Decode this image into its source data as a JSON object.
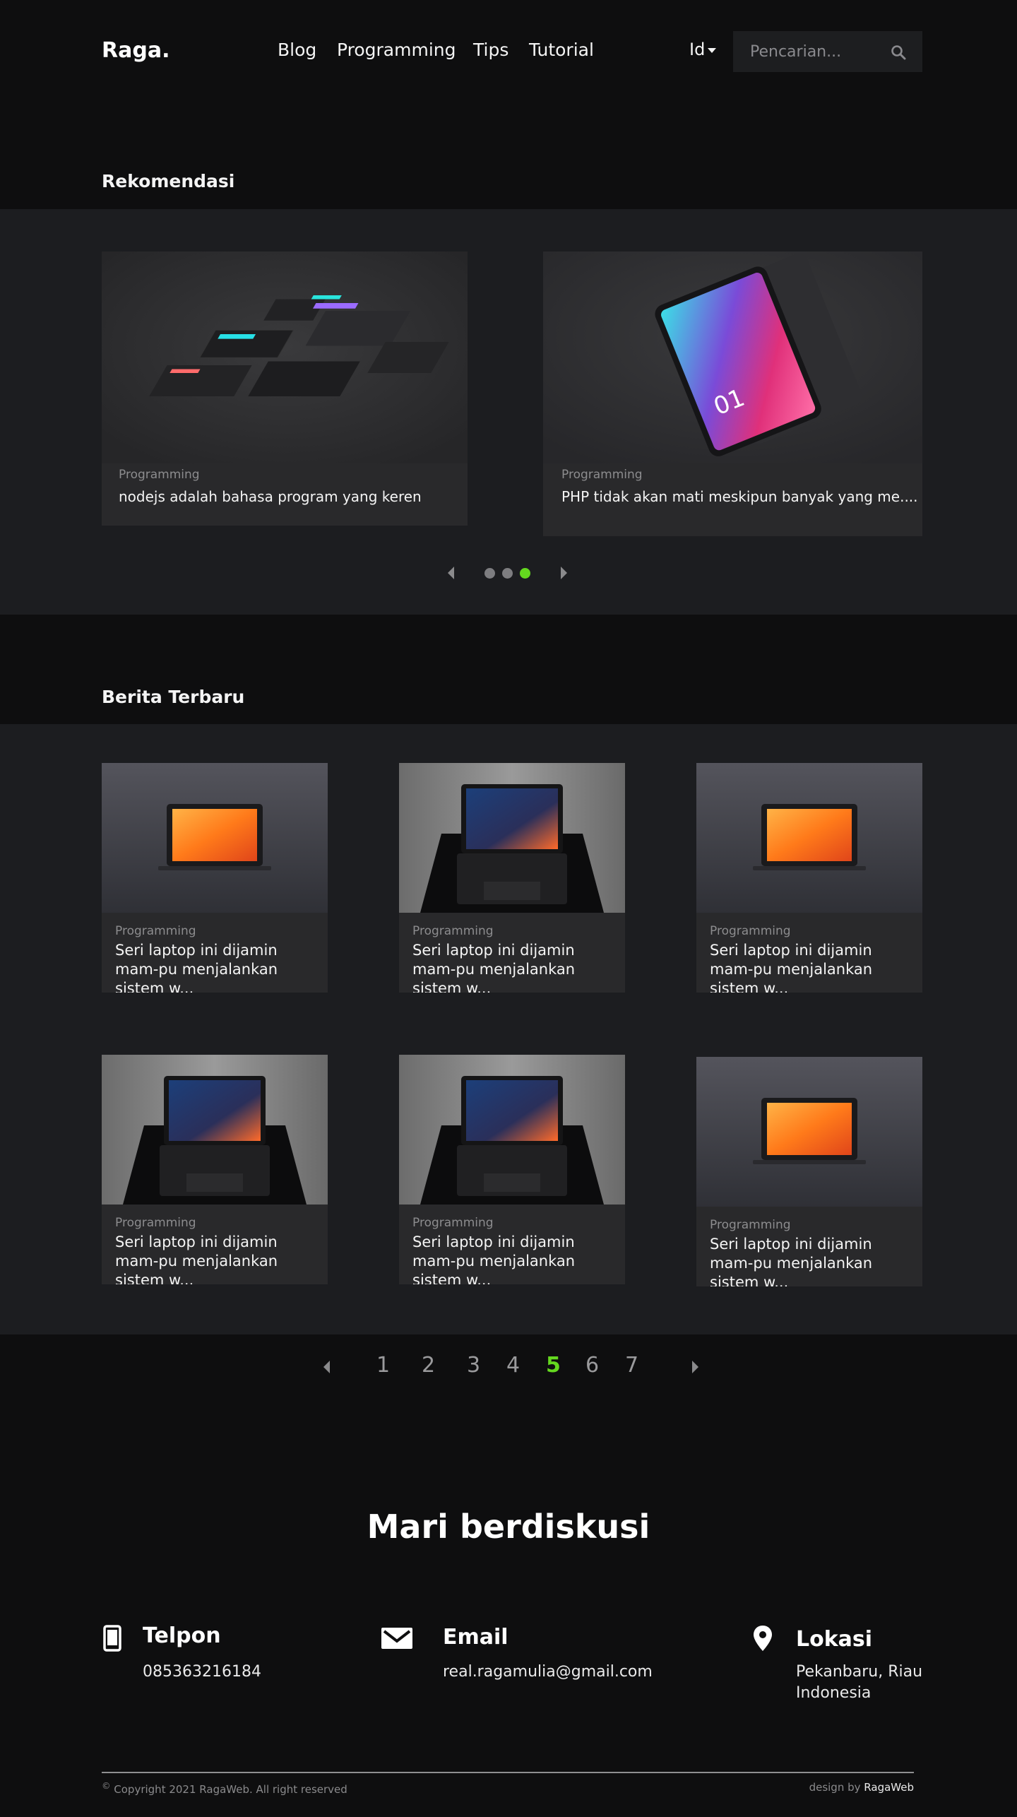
{
  "header": {
    "logo": "Raga.",
    "nav": [
      "Blog",
      "Programming",
      "Tips",
      "Tutorial"
    ],
    "lang": "Id",
    "search_placeholder": "Pencarian..."
  },
  "recommend": {
    "title": "Rekomendasi",
    "cards": [
      {
        "category": "Programming",
        "title": "nodejs adalah bahasa program yang keren"
      },
      {
        "category": "Programming",
        "title": "PHP tidak akan mati meskipun banyak yang me...."
      }
    ],
    "active_dot": 3,
    "dot_count": 3
  },
  "news": {
    "title": "Berita Terbaru",
    "cards": [
      {
        "category": "Programming",
        "title": "Seri laptop ini dijamin mam-pu menjalankan sistem w..."
      },
      {
        "category": "Programming",
        "title": "Seri laptop ini dijamin mam-pu menjalankan sistem w..."
      },
      {
        "category": "Programming",
        "title": "Seri laptop ini dijamin mam-pu menjalankan sistem w..."
      },
      {
        "category": "Programming",
        "title": "Seri laptop ini dijamin mam-pu menjalankan sistem w..."
      },
      {
        "category": "Programming",
        "title": "Seri laptop ini dijamin mam-pu menjalankan sistem w..."
      },
      {
        "category": "Programming",
        "title": "Seri laptop ini dijamin mam-pu menjalankan sistem w..."
      }
    ]
  },
  "pagination": {
    "pages": [
      "1",
      "2",
      "3",
      "4",
      "5",
      "6",
      "7"
    ],
    "active": "5"
  },
  "footer": {
    "heading": "Mari berdiskusi",
    "phone_label": "Telpon",
    "phone_value": "085363216184",
    "email_label": "Email",
    "email_value": "real.ragamulia@gmail.com",
    "location_label": "Lokasi",
    "location_line1": "Pekanbaru, Riau",
    "location_line2": "Indonesia",
    "copyright": "Copyright 2021 RagaWeb. All right reserved",
    "copyright_symbol": "©",
    "credit_prefix": "design by",
    "credit_name": "RagaWeb"
  },
  "colors": {
    "accent": "#64d81f",
    "bg": "#0e0e0f",
    "band": "#1c1d20",
    "card": "#29292b"
  }
}
